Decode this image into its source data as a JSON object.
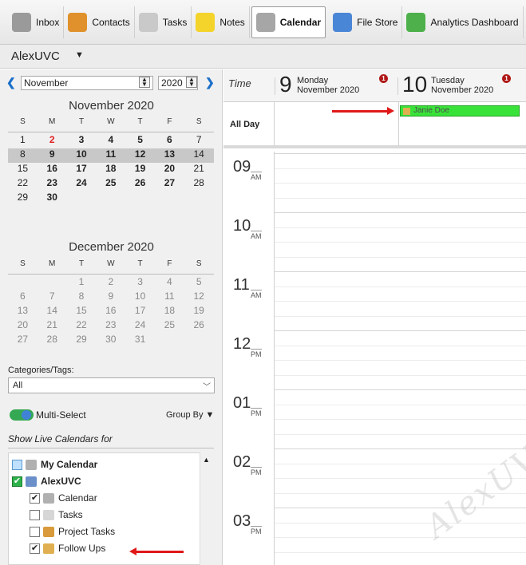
{
  "toolbar": {
    "items": [
      {
        "label": "Inbox",
        "icon": "inbox-icon",
        "color": "#9a9a9a"
      },
      {
        "label": "Contacts",
        "icon": "contacts-icon",
        "color": "#e0912b"
      },
      {
        "label": "Tasks",
        "icon": "tasks-icon",
        "color": "#c9c9c9"
      },
      {
        "label": "Notes",
        "icon": "notes-icon",
        "color": "#f4d32a"
      },
      {
        "label": "Calendar",
        "icon": "calendar-icon",
        "color": "#a6a6a6",
        "active": true
      },
      {
        "label": "File Store",
        "icon": "file-store-icon",
        "color": "#4a86d6"
      },
      {
        "label": "Analytics Dashboard",
        "icon": "analytics-icon",
        "color": "#4db04a"
      }
    ]
  },
  "account": {
    "name": "AlexUVC"
  },
  "mini_nav": {
    "month": "November",
    "year": "2020"
  },
  "november": {
    "title": "November 2020",
    "dow": [
      "S",
      "M",
      "T",
      "W",
      "T",
      "F",
      "S"
    ],
    "weeks": [
      [
        "1",
        "2",
        "3",
        "4",
        "5",
        "6",
        "7"
      ],
      [
        "8",
        "9",
        "10",
        "11",
        "12",
        "13",
        "14"
      ],
      [
        "15",
        "16",
        "17",
        "18",
        "19",
        "20",
        "21"
      ],
      [
        "22",
        "23",
        "24",
        "25",
        "26",
        "27",
        "28"
      ],
      [
        "29",
        "30",
        "",
        "",
        "",
        "",
        ""
      ]
    ]
  },
  "december": {
    "title": "December 2020",
    "dow": [
      "S",
      "M",
      "T",
      "W",
      "T",
      "F",
      "S"
    ],
    "weeks": [
      [
        "",
        "",
        "1",
        "2",
        "3",
        "4",
        "5"
      ],
      [
        "6",
        "7",
        "8",
        "9",
        "10",
        "11",
        "12"
      ],
      [
        "13",
        "14",
        "15",
        "16",
        "17",
        "18",
        "19"
      ],
      [
        "20",
        "21",
        "22",
        "23",
        "24",
        "25",
        "26"
      ],
      [
        "27",
        "28",
        "29",
        "30",
        "31",
        "",
        ""
      ]
    ]
  },
  "categories": {
    "label": "Categories/Tags:",
    "value": "All"
  },
  "multi_select": {
    "label": "Multi-Select",
    "group_by": "Group By"
  },
  "live": {
    "title": "Show Live Calendars for"
  },
  "tree": [
    {
      "label": "My Calendar",
      "checked": false,
      "bold": true,
      "indent": 0,
      "icon": "calendar-small-icon"
    },
    {
      "label": "AlexUVC",
      "checked": true,
      "bold": true,
      "indent": 0,
      "icon": "user-icon"
    },
    {
      "label": "Calendar",
      "checked": true,
      "bold": false,
      "indent": 1,
      "icon": "calendar-small-icon"
    },
    {
      "label": "Tasks",
      "checked": false,
      "bold": false,
      "indent": 1,
      "icon": "tasks-small-icon"
    },
    {
      "label": "Project Tasks",
      "checked": false,
      "bold": false,
      "indent": 1,
      "icon": "project-icon"
    },
    {
      "label": "Follow Ups",
      "checked": true,
      "bold": false,
      "indent": 1,
      "icon": "flag-icon"
    }
  ],
  "calendar": {
    "time_label": "Time",
    "days": [
      {
        "num": "9",
        "name": "Monday",
        "month": "November 2020",
        "badge": "1"
      },
      {
        "num": "10",
        "name": "Tuesday",
        "month": "November 2020",
        "badge": "1"
      }
    ],
    "all_day_label": "All Day",
    "event": {
      "title": "Janie Doe",
      "color": "#39e239"
    },
    "hours": [
      {
        "h": "09",
        "ampm": "AM"
      },
      {
        "h": "10",
        "ampm": "AM"
      },
      {
        "h": "11",
        "ampm": "AM"
      },
      {
        "h": "12",
        "ampm": "PM"
      },
      {
        "h": "01",
        "ampm": "PM"
      },
      {
        "h": "02",
        "ampm": "PM"
      },
      {
        "h": "03",
        "ampm": "PM"
      }
    ],
    "watermark": "AlexUVC"
  }
}
